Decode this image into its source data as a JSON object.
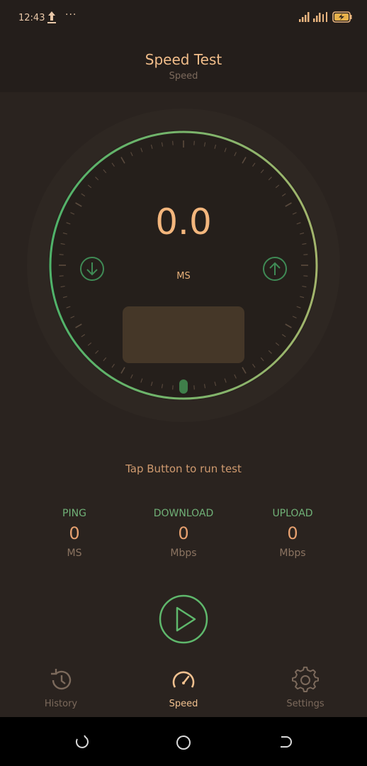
{
  "status_bar": {
    "time": "12:43",
    "icons": [
      "upload-arrow-icon",
      "more-dots-icon",
      "signal-icon",
      "signal-icon",
      "battery-charging-icon"
    ],
    "dots": "···"
  },
  "header": {
    "title": "Speed Test",
    "subtitle": "Speed"
  },
  "gauge": {
    "value": "0.0",
    "unit": "MS",
    "left_icon": "download-arrow-icon",
    "right_icon": "upload-arrow-icon",
    "progress": 0.0
  },
  "hint": "Tap Button to run test",
  "stats": [
    {
      "label": "PING",
      "value": "0",
      "unit": "MS"
    },
    {
      "label": "DOWNLOAD",
      "value": "0",
      "unit": "Mbps"
    },
    {
      "label": "UPLOAD",
      "value": "0",
      "unit": "Mbps"
    }
  ],
  "play_button": {
    "icon": "play-icon"
  },
  "bottom_nav": [
    {
      "label": "History",
      "icon": "history-icon",
      "active": false
    },
    {
      "label": "Speed",
      "icon": "speedometer-icon",
      "active": true
    },
    {
      "label": "Settings",
      "icon": "gear-icon",
      "active": false
    }
  ],
  "system_nav": [
    "recents-icon",
    "home-icon",
    "back-icon"
  ],
  "colors": {
    "background": "#2a231f",
    "accent_green": "#5fb86c",
    "accent_orange": "#f3b67d",
    "panel": "#453728"
  }
}
